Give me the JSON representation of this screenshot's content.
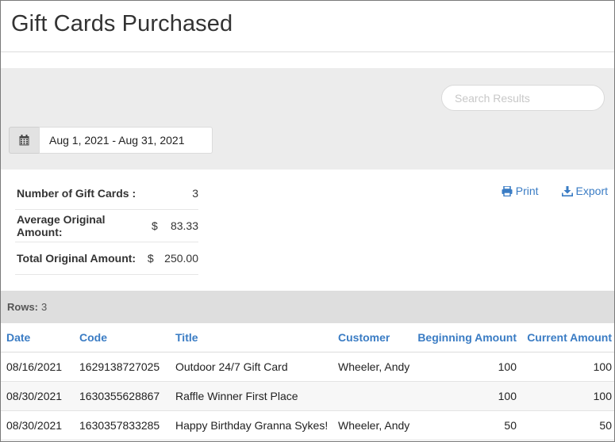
{
  "page": {
    "title": "Gift Cards Purchased"
  },
  "filters": {
    "search_placeholder": "Search Results",
    "date_range": "Aug 1, 2021 - Aug 31, 2021",
    "calendar_icon": "calendar-icon"
  },
  "summary": {
    "count_label": "Number of Gift Cards :",
    "count_value": "3",
    "avg_label": "Average Original Amount:",
    "avg_currency": "$",
    "avg_value": "83.33",
    "total_label": "Total Original Amount:",
    "total_currency": "$",
    "total_value": "250.00"
  },
  "actions": {
    "print_label": "Print",
    "export_label": "Export",
    "print_icon": "printer-icon",
    "export_icon": "download-icon"
  },
  "rows_info": {
    "label": "Rows:",
    "count": "3"
  },
  "table": {
    "headers": [
      "Date",
      "Code",
      "Title",
      "Customer",
      "Beginning Amount",
      "Current Amount"
    ],
    "rows": [
      [
        "08/16/2021",
        "1629138727025",
        "Outdoor 24/7 Gift Card",
        "Wheeler, Andy",
        "100",
        "100"
      ],
      [
        "08/30/2021",
        "1630355628867",
        "Raffle Winner First Place",
        "",
        "100",
        "100"
      ],
      [
        "08/30/2021",
        "1630357833285",
        "Happy Birthday Granna Sykes!",
        "Wheeler, Andy",
        "50",
        "50"
      ]
    ]
  },
  "colors": {
    "link": "#3a7cc4",
    "band": "#ececec",
    "rows_bar": "#dedede"
  }
}
